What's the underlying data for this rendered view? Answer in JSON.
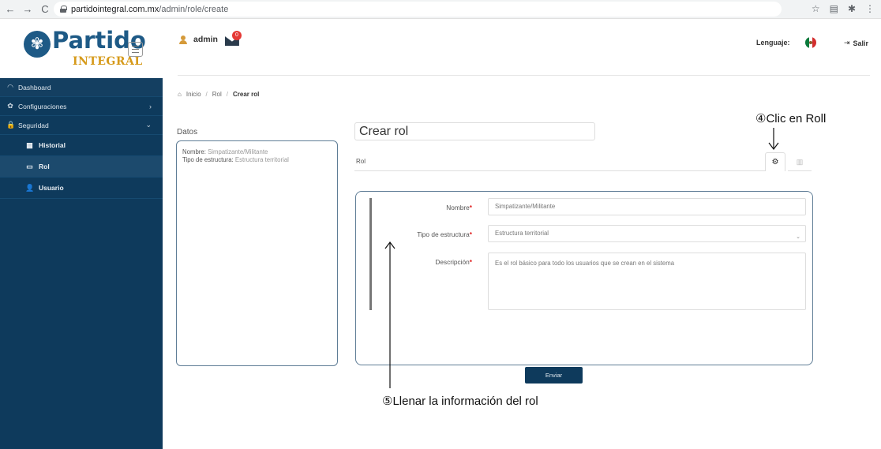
{
  "browser": {
    "back": "←",
    "forward": "→",
    "reload": "C",
    "url_host": "partidointegral.com.mx",
    "url_path": "/admin/role/create",
    "icons": [
      "☆",
      "▤",
      "✱",
      "⋮"
    ]
  },
  "brand": {
    "logo_glyph": "✾",
    "name": "Partido",
    "sub": "INTEGRAL"
  },
  "sidebar": {
    "items": [
      {
        "icon": "◠",
        "label": "Dashboard"
      },
      {
        "icon": "✿",
        "label": "Configuraciones",
        "chevron": "›"
      },
      {
        "icon": "🔒",
        "label": "Seguridad",
        "chevron": "⌄"
      }
    ],
    "subitems": [
      {
        "icon": "▦",
        "label": "Historial"
      },
      {
        "icon": "▭",
        "label": "Rol"
      },
      {
        "icon": "👤",
        "label": "Usuario"
      }
    ]
  },
  "topbar": {
    "user": "admin",
    "mail_count": "0",
    "language_label": "Lenguaje:",
    "logout_icon": "⇥",
    "logout_label": "Salir"
  },
  "breadcrumb": {
    "home_icon": "⌂",
    "items": [
      "Inicio",
      "Rol",
      "Crear rol"
    ],
    "separator": "/"
  },
  "datos": {
    "title": "Datos",
    "nombre_key": "Nombre:",
    "nombre_value": "Simpatizante/Militante",
    "tipo_key": "Tipo de estructura:",
    "tipo_value": "Estructura territorial"
  },
  "main": {
    "page_title": "Crear rol",
    "section_label": "Rol",
    "tab_gear": "⚙",
    "tab_map": "▥"
  },
  "form": {
    "nombre_label": "Nombre",
    "nombre_value": "Simpatizante/Militante",
    "tipo_label": "Tipo de estructura",
    "tipo_value": "Estructura territorial",
    "tipo_caret": "⌄",
    "descripcion_label": "Descripción",
    "descripcion_value": "Es el rol básico para todo los usuarios que se crean en el sistema",
    "required_mark": "*",
    "submit_label": "Enviar"
  },
  "annotations": {
    "step4": "④Clic en Roll",
    "step5": "⑤Llenar la información del rol"
  }
}
